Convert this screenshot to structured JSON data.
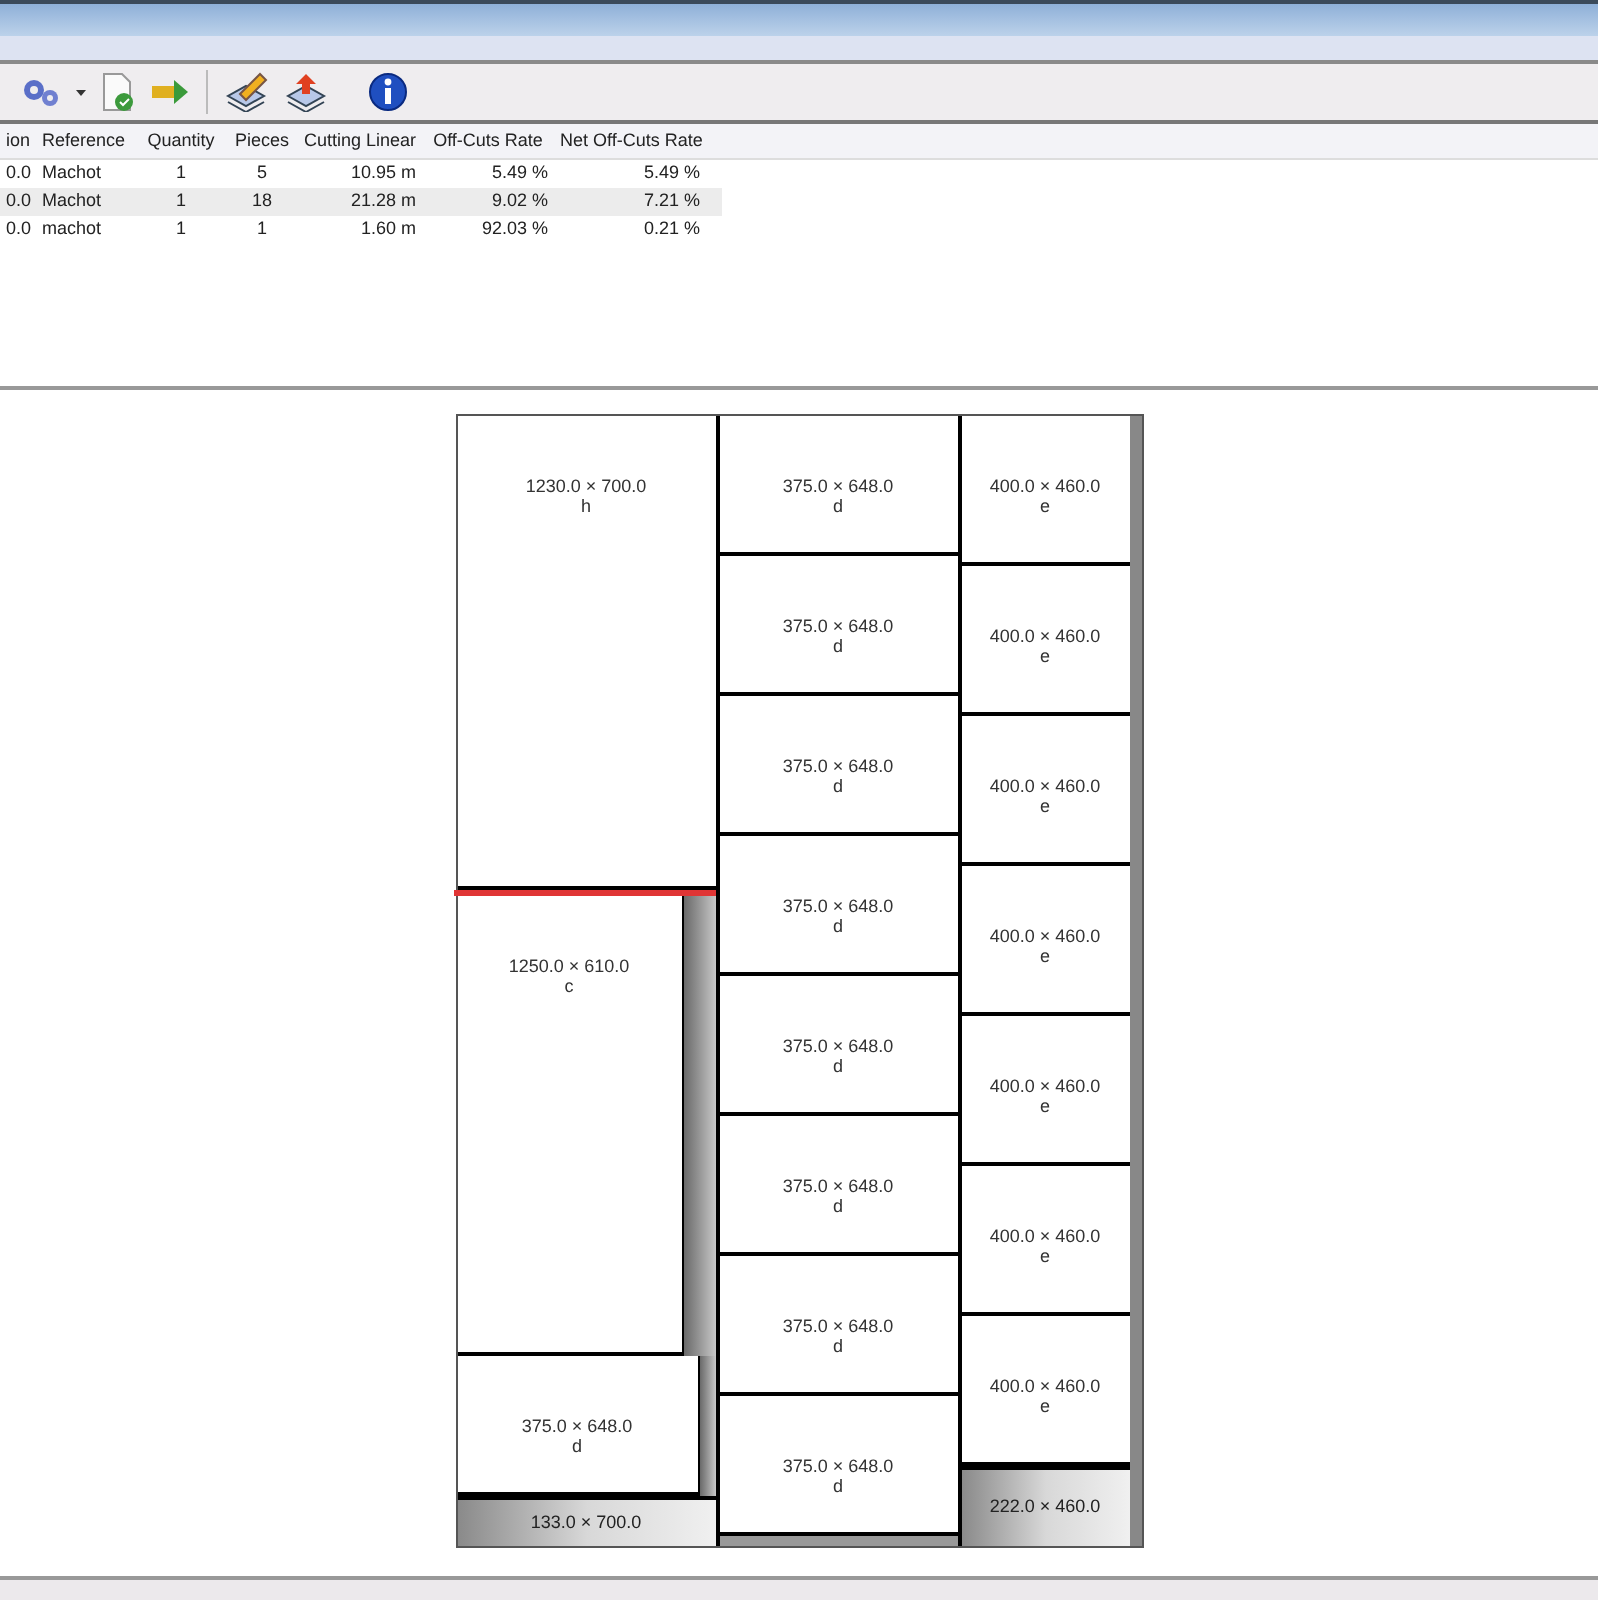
{
  "table": {
    "columns": [
      "ion",
      "Reference",
      "Quantity",
      "Pieces",
      "Cutting Linear",
      "Off-Cuts Rate",
      "Net Off-Cuts Rate"
    ],
    "rows": [
      {
        "selected": false,
        "cells": [
          "0.0",
          "Machot",
          "1",
          "5",
          "10.95 m",
          "5.49 %",
          "5.49 %"
        ]
      },
      {
        "selected": true,
        "cells": [
          "0.0",
          "Machot",
          "1",
          "18",
          "21.28 m",
          "9.02 %",
          "7.21 %"
        ]
      },
      {
        "selected": false,
        "cells": [
          "0.0",
          "machot",
          "1",
          "1",
          "1.60 m",
          "92.03 %",
          "0.21 %"
        ]
      }
    ]
  },
  "sheet": {
    "columns": [
      {
        "pieces": [
          {
            "kind": "piece",
            "size": "1230.0 × 700.0",
            "code": "h"
          },
          {
            "kind": "cut"
          },
          {
            "kind": "split",
            "main": {
              "size": "1250.0 × 610.0",
              "code": "c"
            }
          },
          {
            "kind": "split",
            "main": {
              "size": "375.0 × 648.0",
              "code": "d"
            }
          },
          {
            "kind": "waste",
            "size": "133.0 × 700.0"
          }
        ]
      },
      {
        "pieces": [
          {
            "kind": "piece",
            "size": "375.0 × 648.0",
            "code": "d"
          },
          {
            "kind": "piece",
            "size": "375.0 × 648.0",
            "code": "d"
          },
          {
            "kind": "piece",
            "size": "375.0 × 648.0",
            "code": "d"
          },
          {
            "kind": "piece",
            "size": "375.0 × 648.0",
            "code": "d"
          },
          {
            "kind": "piece",
            "size": "375.0 × 648.0",
            "code": "d"
          },
          {
            "kind": "piece",
            "size": "375.0 × 648.0",
            "code": "d"
          },
          {
            "kind": "piece",
            "size": "375.0 × 648.0",
            "code": "d"
          },
          {
            "kind": "piece",
            "size": "375.0 × 648.0",
            "code": "d"
          }
        ]
      },
      {
        "pieces": [
          {
            "kind": "piece",
            "size": "400.0 × 460.0",
            "code": "e"
          },
          {
            "kind": "piece",
            "size": "400.0 × 460.0",
            "code": "e"
          },
          {
            "kind": "piece",
            "size": "400.0 × 460.0",
            "code": "e"
          },
          {
            "kind": "piece",
            "size": "400.0 × 460.0",
            "code": "e"
          },
          {
            "kind": "piece",
            "size": "400.0 × 460.0",
            "code": "e"
          },
          {
            "kind": "piece",
            "size": "400.0 × 460.0",
            "code": "e"
          },
          {
            "kind": "piece",
            "size": "400.0 × 460.0",
            "code": "e"
          },
          {
            "kind": "waste",
            "size": "222.0 × 460.0"
          }
        ]
      }
    ]
  }
}
